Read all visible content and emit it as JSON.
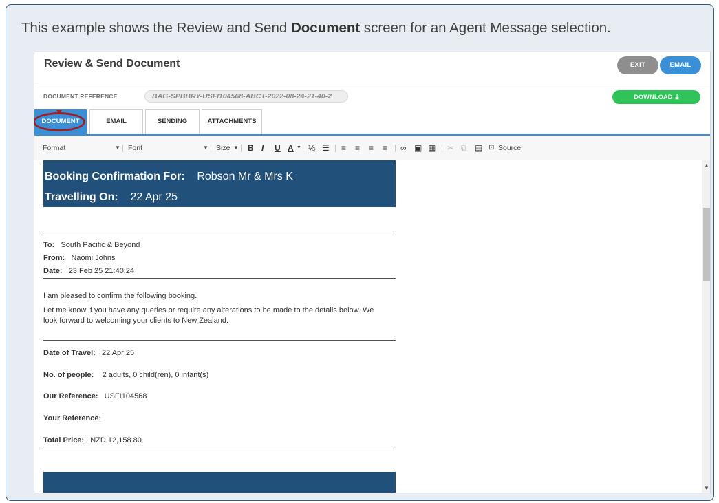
{
  "caption": {
    "pre": "This example shows the Review and Send ",
    "bold": "Document",
    "post": " screen for an Agent Message selection."
  },
  "header": {
    "title": "Review & Send Document",
    "exit_label": "EXIT",
    "email_label": "EMAIL"
  },
  "docref": {
    "label": "DOCUMENT REFERENCE",
    "value": "BAG-SPBBRY-USFI104568-ABCT-2022-08-24-21-40-2",
    "download_label": "DOWNLOAD"
  },
  "tabs": [
    {
      "label": "DOCUMENT",
      "active": true
    },
    {
      "label": "EMAIL",
      "active": false
    },
    {
      "label": "SENDING",
      "active": false
    },
    {
      "label": "ATTACHMENTS",
      "active": false
    }
  ],
  "toolbar": {
    "format": "Format",
    "font": "Font",
    "size": "Size",
    "source": "Source"
  },
  "document": {
    "banner_l1_label": "Booking Confirmation For:",
    "banner_l1_value": "Robson Mr & Mrs K",
    "banner_l2_label": "Travelling On:",
    "banner_l2_value": "22 Apr 25",
    "to_label": "To:",
    "to_value": "South Pacific & Beyond",
    "from_label": "From:",
    "from_value": "Naomi Johns",
    "date_label": "Date:",
    "date_value": "23 Feb 25 21:40:24",
    "para1": "I am pleased to confirm the following booking.",
    "para2a": "Let me know if you have any queries or require any alterations to be made to the details below. We",
    "para2b": "look forward to welcoming your clients to New Zealand.",
    "travel_label": "Date of Travel:",
    "travel_value": "22 Apr 25",
    "people_label": "No. of people:",
    "people_value": "2 adults, 0 child(ren), 0 infant(s)",
    "ourref_label": "Our Reference:",
    "ourref_value": "USFI104568",
    "yourref_label": "Your Reference:",
    "total_label": "Total Price:",
    "total_value": "NZD 12,158.80"
  },
  "colors": {
    "accent": "#3a8fd6",
    "download": "#30c35a",
    "banner": "#21507b",
    "highlight": "#9c1f24"
  }
}
